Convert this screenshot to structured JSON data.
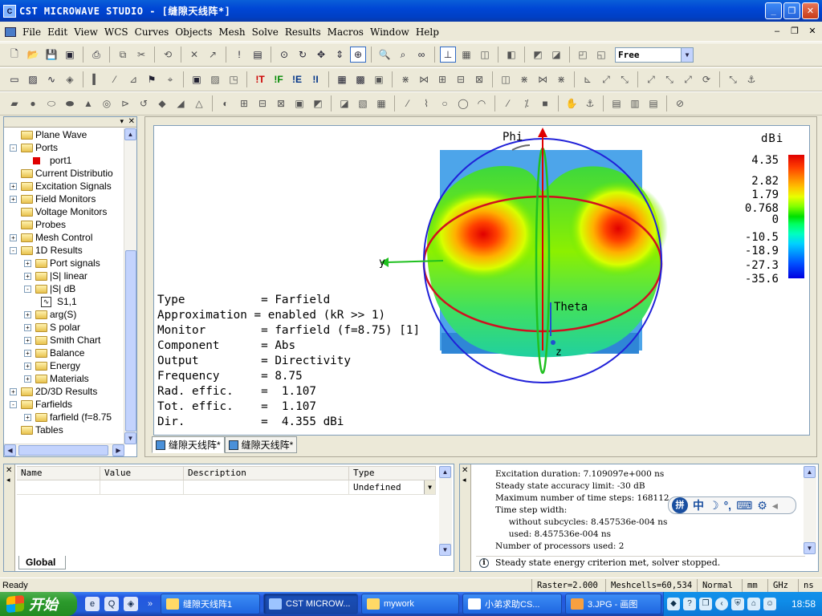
{
  "window": {
    "title": "CST MICROWAVE STUDIO - [缝隙天线阵*]"
  },
  "menu": [
    "File",
    "Edit",
    "View",
    "WCS",
    "Curves",
    "Objects",
    "Mesh",
    "Solve",
    "Results",
    "Macros",
    "Window",
    "Help"
  ],
  "toolbar": {
    "mode_select": "Free"
  },
  "tree": [
    {
      "label": "Plane Wave",
      "lvl": 1,
      "exp": "",
      "icon": "folder"
    },
    {
      "label": "Ports",
      "lvl": 1,
      "exp": "-",
      "icon": "folder"
    },
    {
      "label": "port1",
      "lvl": 2,
      "exp": "",
      "icon": "port"
    },
    {
      "label": "Current Distributio",
      "lvl": 1,
      "exp": "",
      "icon": "folder"
    },
    {
      "label": "Excitation Signals",
      "lvl": 1,
      "exp": "+",
      "icon": "folder"
    },
    {
      "label": "Field Monitors",
      "lvl": 1,
      "exp": "+",
      "icon": "folder"
    },
    {
      "label": "Voltage Monitors",
      "lvl": 1,
      "exp": "",
      "icon": "folder"
    },
    {
      "label": "Probes",
      "lvl": 1,
      "exp": "",
      "icon": "folder"
    },
    {
      "label": "Mesh Control",
      "lvl": 1,
      "exp": "+",
      "icon": "folder"
    },
    {
      "label": "1D Results",
      "lvl": 1,
      "exp": "-",
      "icon": "folder"
    },
    {
      "label": "Port signals",
      "lvl": 2,
      "exp": "+",
      "icon": "folder"
    },
    {
      "label": "|S| linear",
      "lvl": 2,
      "exp": "+",
      "icon": "folder"
    },
    {
      "label": "|S| dB",
      "lvl": 2,
      "exp": "-",
      "icon": "folder"
    },
    {
      "label": "S1,1",
      "lvl": 3,
      "exp": "",
      "icon": "graph"
    },
    {
      "label": "arg(S)",
      "lvl": 2,
      "exp": "+",
      "icon": "folder"
    },
    {
      "label": "S polar",
      "lvl": 2,
      "exp": "+",
      "icon": "folder"
    },
    {
      "label": "Smith Chart",
      "lvl": 2,
      "exp": "+",
      "icon": "folder"
    },
    {
      "label": "Balance",
      "lvl": 2,
      "exp": "+",
      "icon": "folder"
    },
    {
      "label": "Energy",
      "lvl": 2,
      "exp": "+",
      "icon": "folder"
    },
    {
      "label": "Materials",
      "lvl": 2,
      "exp": "+",
      "icon": "folder"
    },
    {
      "label": "2D/3D Results",
      "lvl": 1,
      "exp": "+",
      "icon": "folder"
    },
    {
      "label": "Farfields",
      "lvl": 1,
      "exp": "-",
      "icon": "folder"
    },
    {
      "label": "farfield (f=8.75",
      "lvl": 2,
      "exp": "+",
      "icon": "folder"
    },
    {
      "label": "Tables",
      "lvl": 1,
      "exp": "",
      "icon": "folder"
    }
  ],
  "farfield_info": [
    "Type           = Farfield",
    "Approximation = enabled (kR >> 1)",
    "Monitor        = farfield (f=8.75) [1]",
    "Component      = Abs",
    "Output         = Directivity",
    "Frequency      = 8.75",
    "Rad. effic.    =  1.107",
    "Tot. effic.    =  1.107",
    "Dir.           =  4.355 dBi"
  ],
  "axes": {
    "phi": "Phi",
    "theta": "Theta",
    "y": "y",
    "z": "z"
  },
  "legend": {
    "unit": "dBi",
    "values": [
      "4.35",
      "2.82",
      "1.79",
      "0.768",
      "0",
      "-10.5",
      "-18.9",
      "-27.3",
      "-35.6"
    ]
  },
  "doc_tabs": [
    "缝隙天线阵*",
    "缝隙天线阵*"
  ],
  "param_table": {
    "headers": [
      "Name",
      "Value",
      "Description",
      "Type"
    ],
    "type_value": "Undefined",
    "tab": "Global"
  },
  "messages": [
    "Excitation duration: 7.109097e+000 ns",
    "Steady state accuracy limit: -30 dB",
    "Maximum number of time steps: 168112",
    "Time step width:",
    "     without subcycles: 8.457536e-004 ns",
    "     used: 8.457536e-004 ns",
    "Number of processors used: 2"
  ],
  "final_message": "Steady state energy criterion met, solver stopped.",
  "status": {
    "ready": "Ready",
    "raster": "Raster=2.000",
    "meshcells": "Meshcells=60,534",
    "mode": "Normal",
    "unit_len": "mm",
    "unit_freq": "GHz",
    "unit_time": "ns"
  },
  "taskbar": {
    "start": "开始",
    "buttons": [
      "缝隙天线阵1",
      "CST MICROW...",
      "mywork",
      "小弟求助CS...",
      "3.JPG - 画图"
    ],
    "clock": "18:58"
  },
  "ime": {
    "label": "中"
  }
}
